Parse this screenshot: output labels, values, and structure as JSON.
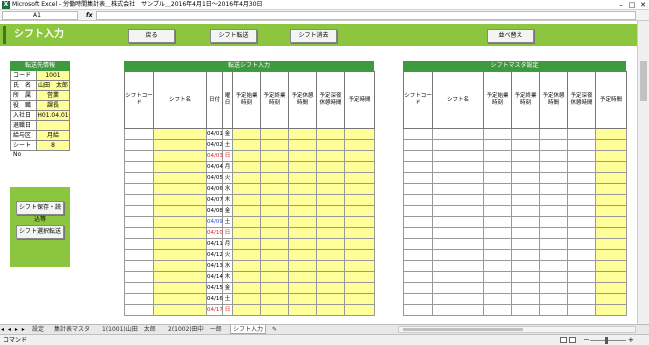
{
  "window": {
    "title": "Microsoft Excel - 労働時間集計表＿株式会社　サンプル＿2016年4月1日～2016年4月30日",
    "minimize": "–",
    "maximize": "□",
    "close": "✕"
  },
  "formula_bar": {
    "cell_ref": "A1",
    "fx": "fx",
    "content": ""
  },
  "banner": {
    "title": "シフト入力",
    "back_label": "戻る",
    "transfer_label": "シフト転送",
    "clear_label": "シフト消去",
    "sort_label": "並べ替え"
  },
  "employee": {
    "header": "転送先情報",
    "rows": [
      {
        "key": "コード",
        "value": "1001"
      },
      {
        "key": "氏　名",
        "value": "山田　太郎"
      },
      {
        "key": "所　属",
        "value": "営業"
      },
      {
        "key": "役　職",
        "value": "課長"
      },
      {
        "key": "入社日",
        "value": "H01.04.01"
      },
      {
        "key": "退職日",
        "value": ""
      },
      {
        "key": "給与区分",
        "value": "月給"
      },
      {
        "key": "シートNo",
        "value": "8"
      }
    ]
  },
  "actions": {
    "save_label": "シフト保存・読込等",
    "select_label": "シフト選択転送"
  },
  "transfer_table": {
    "header": "転送シフト入力",
    "columns": [
      "シフトコード",
      "シフト名",
      "日付",
      "曜日",
      "予定始業時刻",
      "予定終業時刻",
      "予定休憩時間",
      "予定深夜休憩時間",
      "予定時間"
    ],
    "rows": [
      {
        "date": "04/01",
        "dow": "金",
        "color": "black"
      },
      {
        "date": "04/02",
        "dow": "土",
        "color": "black"
      },
      {
        "date": "04/03",
        "dow": "日",
        "color": "red"
      },
      {
        "date": "04/04",
        "dow": "月",
        "color": "black"
      },
      {
        "date": "04/05",
        "dow": "火",
        "color": "black"
      },
      {
        "date": "04/06",
        "dow": "水",
        "color": "black"
      },
      {
        "date": "04/07",
        "dow": "木",
        "color": "black"
      },
      {
        "date": "04/08",
        "dow": "金",
        "color": "black"
      },
      {
        "date": "04/09",
        "dow": "土",
        "color": "blue"
      },
      {
        "date": "04/10",
        "dow": "日",
        "color": "red"
      },
      {
        "date": "04/11",
        "dow": "月",
        "color": "black"
      },
      {
        "date": "04/12",
        "dow": "火",
        "color": "black"
      },
      {
        "date": "04/13",
        "dow": "水",
        "color": "black"
      },
      {
        "date": "04/14",
        "dow": "木",
        "color": "black"
      },
      {
        "date": "04/15",
        "dow": "金",
        "color": "black"
      },
      {
        "date": "04/16",
        "dow": "土",
        "color": "black"
      },
      {
        "date": "04/17",
        "dow": "日",
        "color": "red"
      }
    ]
  },
  "master_table": {
    "header": "シフトマスタ設定",
    "columns": [
      "シフトコード",
      "シフト名",
      "予定始業時刻",
      "予定終業時刻",
      "予定休憩時間",
      "予定深夜休憩時間",
      "予定時間"
    ],
    "row_count": 17
  },
  "sheet_tabs": {
    "nav": "◂ ◂ ▸ ▸",
    "tabs": [
      "設定",
      "集計表マスタ",
      "1(1001)山田　太郎",
      "2(1002)田中　一郎",
      "シフト入力",
      "✎"
    ],
    "active_index": 4
  },
  "status": {
    "text": "コマンド",
    "zoom_minus": "－",
    "zoom_plus": "+"
  },
  "colors": {
    "banner": "#8cc63f",
    "header_green": "#3d9b3d",
    "input_yellow": "#ffff99",
    "sunday_red": "#e02020",
    "saturday_blue": "#2050e0"
  }
}
